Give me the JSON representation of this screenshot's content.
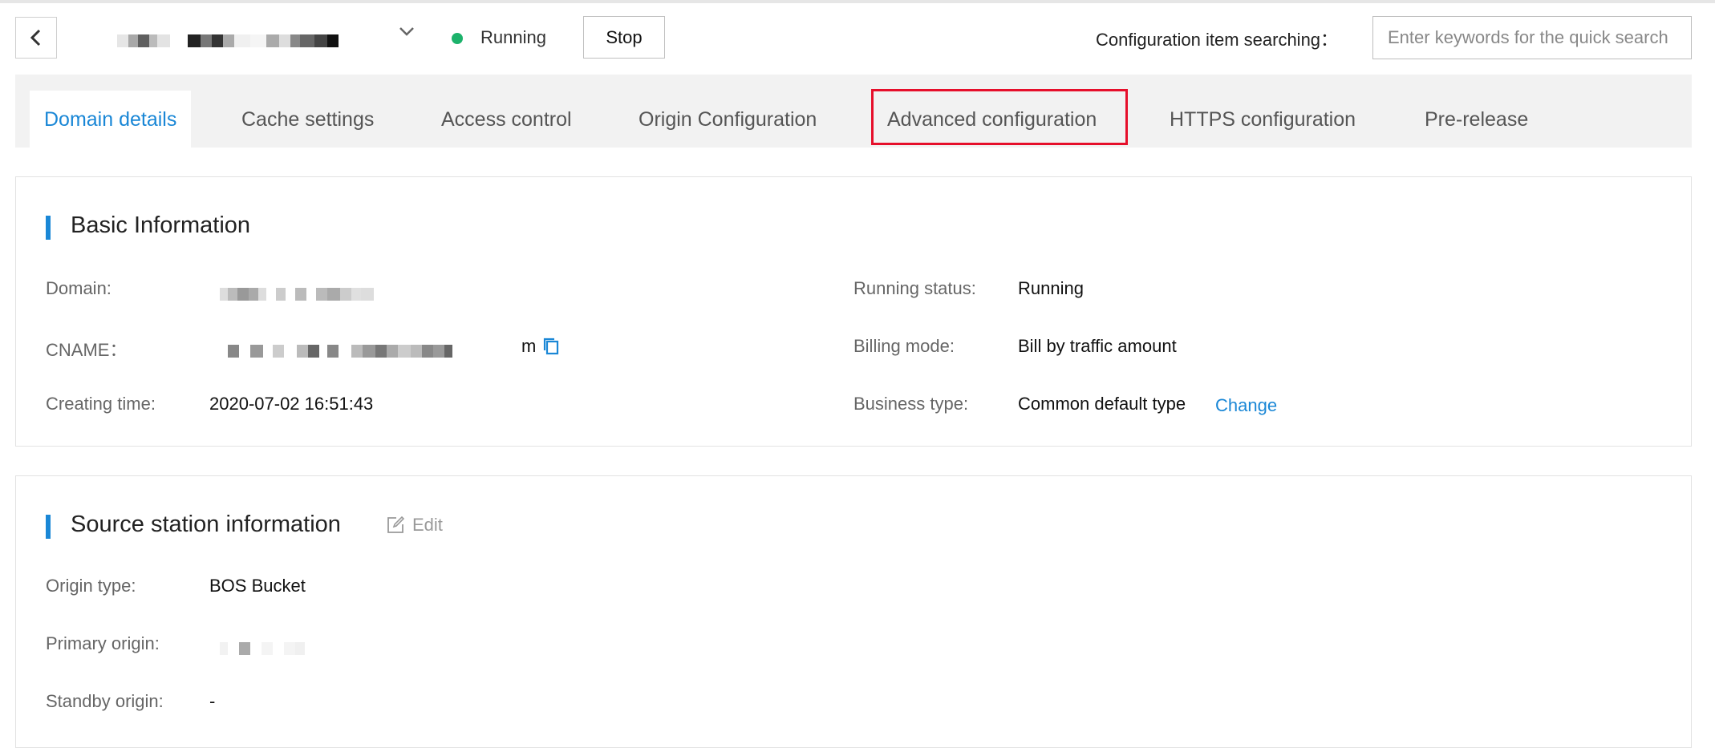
{
  "header": {
    "back_icon": "chevron-left-icon",
    "domain_select_icon": "chevron-down-icon",
    "status_text": "Running",
    "status_color": "#1cb26b",
    "stop_label": "Stop",
    "search_label": "Configuration item searching：",
    "search_placeholder": "Enter keywords for the quick search"
  },
  "tabs": [
    {
      "label": "Domain details"
    },
    {
      "label": "Cache settings"
    },
    {
      "label": "Access control"
    },
    {
      "label": "Origin Configuration"
    },
    {
      "label": "Advanced configuration"
    },
    {
      "label": "HTTPS configuration"
    },
    {
      "label": "Pre-release"
    }
  ],
  "basic_info": {
    "title": "Basic Information",
    "domain_label": "Domain:",
    "cname_label": "CNAME：",
    "cname_suffix": "m",
    "copy_icon": "copy-icon",
    "creating_time_label": "Creating time:",
    "creating_time_value": "2020-07-02 16:51:43",
    "running_status_label": "Running status:",
    "running_status_value": "Running",
    "billing_mode_label": "Billing mode:",
    "billing_mode_value": "Bill by traffic amount",
    "business_type_label": "Business type:",
    "business_type_value": "Common default type",
    "change_link": "Change"
  },
  "source_info": {
    "title": "Source station information",
    "edit_icon": "edit-icon",
    "edit_label": "Edit",
    "origin_type_label": "Origin type:",
    "origin_type_value": "BOS Bucket",
    "primary_origin_label": "Primary origin:",
    "standby_origin_label": "Standby origin:",
    "standby_origin_value": "-"
  },
  "colors": {
    "accent": "#1a87d6",
    "highlight": "#e60f2b",
    "tab_bar_bg": "#f2f2f2"
  }
}
